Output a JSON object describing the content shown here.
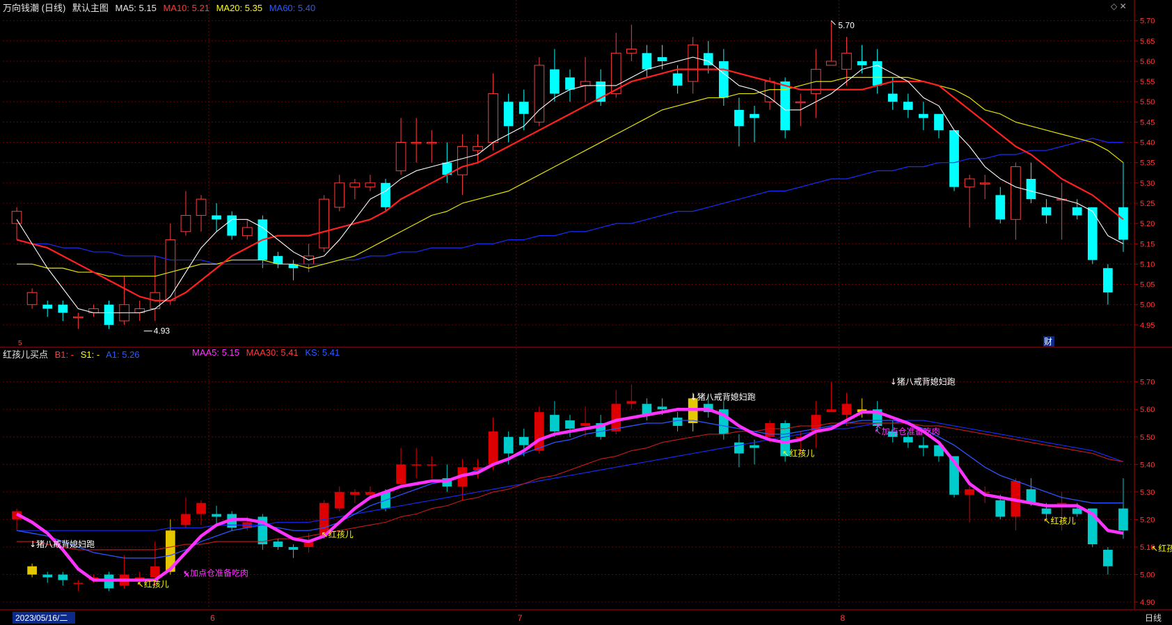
{
  "upper": {
    "title": "万向钱潮 (日线)",
    "indicator_name": "默认主图",
    "ma5": "MA5: 5.15",
    "ma10": "MA10: 5.21",
    "ma20": "MA20: 5.35",
    "ma60": "MA60: 5.40",
    "high_label": "5.70",
    "low_label": "4.93",
    "fin_marker": "财",
    "small_marker": "5"
  },
  "lower": {
    "indicator_name": "红孩儿买点",
    "b1": "B1: -",
    "s1": "S1: -",
    "a1": "A1: 5.26",
    "maa5": "MAA5: 5.15",
    "maa30": "MAA30: 5.41",
    "ks": "KS: 5.41",
    "annotations": [
      {
        "text": "↓猪八戒背媳妇跑",
        "color": "#ffffff",
        "bar": 1,
        "price": 5.1
      },
      {
        "text": "↖红孩儿",
        "color": "#ffff00",
        "bar": 8,
        "price": 4.955
      },
      {
        "text": "↖加点仓准备吃肉",
        "color": "#ff33ff",
        "bar": 11,
        "price": 4.995
      },
      {
        "text": "↖红孩儿",
        "color": "#ffff00",
        "bar": 20,
        "price": 5.135
      },
      {
        "text": "↓猪八戒背媳妇跑",
        "color": "#ffffff",
        "bar": 44,
        "price": 5.635
      },
      {
        "text": "↖红孩儿",
        "color": "#ffff00",
        "bar": 50,
        "price": 5.43
      },
      {
        "text": "↓猪八戒背媳妇跑",
        "color": "#ffffff",
        "bar": 57,
        "price": 5.69
      },
      {
        "text": "↖加点仓准备吃肉",
        "color": "#ff33ff",
        "bar": 56,
        "price": 5.51
      },
      {
        "text": "↖红孩儿",
        "color": "#ffff00",
        "bar": 67,
        "price": 5.185
      },
      {
        "text": "↖红孩儿",
        "color": "#ffff00",
        "bar": 74,
        "price": 5.085
      }
    ]
  },
  "bottom": {
    "date_label": "2023/05/16/二",
    "month_labels": [
      "6",
      "7",
      "8"
    ],
    "period": "日线"
  },
  "colors": {
    "up": "#ff3b3b",
    "down_upper": "#00ffff",
    "down_lower": "#00cccc",
    "up_lower": "#dd0000",
    "signal": "#e5c700",
    "ma5": "#ffffff",
    "ma10": "#ff2020",
    "ma20": "#e6e600",
    "ma60": "#1a2cff",
    "maa5": "#ff33ff",
    "grid": "#7a0000"
  },
  "chart_data": {
    "type": "candlestick",
    "ylim_upper": [
      4.9,
      5.72
    ],
    "ylim_lower": [
      4.88,
      5.78
    ],
    "yticks": [
      4.95,
      5.0,
      5.05,
      5.1,
      5.15,
      5.2,
      5.25,
      5.3,
      5.35,
      5.4,
      5.45,
      5.5,
      5.55,
      5.6,
      5.65,
      5.7
    ],
    "yticks_lower": [
      4.9,
      5.0,
      5.1,
      5.2,
      5.3,
      5.4,
      5.5,
      5.6,
      5.7
    ],
    "candles": [
      [
        5.2,
        5.23,
        5.24,
        5.16
      ],
      [
        5.0,
        5.03,
        5.04,
        4.99
      ],
      [
        5.0,
        4.99,
        5.01,
        4.97
      ],
      [
        5.0,
        4.98,
        5.01,
        4.96
      ],
      [
        4.97,
        4.97,
        4.98,
        4.94
      ],
      [
        4.98,
        4.99,
        5.0,
        4.97
      ],
      [
        5.0,
        4.95,
        5.01,
        4.94
      ],
      [
        4.96,
        5.0,
        5.07,
        4.95
      ],
      [
        4.98,
        4.99,
        5.01,
        4.96
      ],
      [
        4.99,
        5.03,
        5.12,
        4.96
      ],
      [
        5.01,
        5.16,
        5.2,
        5.0
      ],
      [
        5.18,
        5.22,
        5.28,
        5.17
      ],
      [
        5.22,
        5.26,
        5.27,
        5.18
      ],
      [
        5.22,
        5.21,
        5.25,
        5.18
      ],
      [
        5.22,
        5.17,
        5.23,
        5.16
      ],
      [
        5.17,
        5.19,
        5.21,
        5.16
      ],
      [
        5.21,
        5.11,
        5.22,
        5.09
      ],
      [
        5.12,
        5.1,
        5.13,
        5.09
      ],
      [
        5.1,
        5.09,
        5.11,
        5.06
      ],
      [
        5.1,
        5.12,
        5.15,
        5.08
      ],
      [
        5.14,
        5.26,
        5.27,
        5.13
      ],
      [
        5.24,
        5.3,
        5.32,
        5.23
      ],
      [
        5.29,
        5.3,
        5.31,
        5.26
      ],
      [
        5.29,
        5.3,
        5.32,
        5.28
      ],
      [
        5.3,
        5.24,
        5.31,
        5.23
      ],
      [
        5.33,
        5.4,
        5.46,
        5.32
      ],
      [
        5.4,
        5.4,
        5.46,
        5.35
      ],
      [
        5.4,
        5.4,
        5.43,
        5.35
      ],
      [
        5.35,
        5.32,
        5.4,
        5.3
      ],
      [
        5.32,
        5.39,
        5.42,
        5.27
      ],
      [
        5.38,
        5.39,
        5.42,
        5.35
      ],
      [
        5.4,
        5.52,
        5.57,
        5.38
      ],
      [
        5.5,
        5.44,
        5.52,
        5.4
      ],
      [
        5.5,
        5.47,
        5.53,
        5.43
      ],
      [
        5.45,
        5.59,
        5.61,
        5.44
      ],
      [
        5.58,
        5.52,
        5.63,
        5.5
      ],
      [
        5.56,
        5.53,
        5.58,
        5.5
      ],
      [
        5.54,
        5.55,
        5.61,
        5.5
      ],
      [
        5.55,
        5.5,
        5.58,
        5.49
      ],
      [
        5.52,
        5.62,
        5.67,
        5.51
      ],
      [
        5.62,
        5.63,
        5.69,
        5.6
      ],
      [
        5.62,
        5.58,
        5.64,
        5.56
      ],
      [
        5.61,
        5.6,
        5.64,
        5.58
      ],
      [
        5.57,
        5.54,
        5.59,
        5.52
      ],
      [
        5.55,
        5.64,
        5.66,
        5.52
      ],
      [
        5.62,
        5.59,
        5.65,
        5.57
      ],
      [
        5.6,
        5.51,
        5.63,
        5.49
      ],
      [
        5.48,
        5.44,
        5.51,
        5.39
      ],
      [
        5.47,
        5.46,
        5.49,
        5.4
      ],
      [
        5.5,
        5.55,
        5.56,
        5.48
      ],
      [
        5.55,
        5.43,
        5.56,
        5.41
      ],
      [
        5.5,
        5.5,
        5.52,
        5.44
      ],
      [
        5.52,
        5.58,
        5.63,
        5.46
      ],
      [
        5.59,
        5.6,
        5.7,
        5.59
      ],
      [
        5.58,
        5.62,
        5.66,
        5.54
      ],
      [
        5.6,
        5.59,
        5.64,
        5.57
      ],
      [
        5.6,
        5.54,
        5.63,
        5.52
      ],
      [
        5.52,
        5.5,
        5.56,
        5.48
      ],
      [
        5.5,
        5.48,
        5.52,
        5.46
      ],
      [
        5.47,
        5.46,
        5.5,
        5.43
      ],
      [
        5.47,
        5.43,
        5.47,
        5.41
      ],
      [
        5.43,
        5.29,
        5.43,
        5.28
      ],
      [
        5.29,
        5.31,
        5.32,
        5.19
      ],
      [
        5.3,
        5.3,
        5.32,
        5.26
      ],
      [
        5.27,
        5.21,
        5.29,
        5.2
      ],
      [
        5.21,
        5.34,
        5.35,
        5.16
      ],
      [
        5.31,
        5.26,
        5.35,
        5.25
      ],
      [
        5.24,
        5.22,
        5.26,
        5.2
      ],
      [
        5.26,
        5.26,
        5.3,
        5.16
      ],
      [
        5.24,
        5.22,
        5.26,
        5.21
      ],
      [
        5.24,
        5.11,
        5.24,
        5.1
      ],
      [
        5.09,
        5.03,
        5.1,
        5.0
      ],
      [
        5.24,
        5.16,
        5.35,
        5.13
      ]
    ],
    "ma5": [
      5.21,
      5.15,
      5.09,
      5.04,
      4.99,
      4.98,
      4.98,
      4.98,
      4.98,
      4.99,
      5.02,
      5.08,
      5.14,
      5.18,
      5.21,
      5.21,
      5.19,
      5.16,
      5.13,
      5.11,
      5.12,
      5.16,
      5.21,
      5.26,
      5.28,
      5.31,
      5.33,
      5.34,
      5.35,
      5.36,
      5.37,
      5.4,
      5.42,
      5.44,
      5.48,
      5.51,
      5.53,
      5.54,
      5.54,
      5.54,
      5.56,
      5.58,
      5.59,
      5.6,
      5.61,
      5.6,
      5.57,
      5.54,
      5.53,
      5.51,
      5.48,
      5.48,
      5.5,
      5.52,
      5.55,
      5.58,
      5.59,
      5.57,
      5.55,
      5.51,
      5.49,
      5.43,
      5.39,
      5.34,
      5.31,
      5.29,
      5.28,
      5.27,
      5.26,
      5.25,
      5.23,
      5.17,
      5.15
    ],
    "ma10": [
      5.16,
      5.15,
      5.14,
      5.12,
      5.1,
      5.08,
      5.06,
      5.04,
      5.02,
      5.01,
      5.01,
      5.03,
      5.06,
      5.09,
      5.12,
      5.14,
      5.16,
      5.17,
      5.17,
      5.17,
      5.18,
      5.19,
      5.2,
      5.21,
      5.23,
      5.26,
      5.28,
      5.3,
      5.32,
      5.34,
      5.35,
      5.37,
      5.39,
      5.41,
      5.43,
      5.45,
      5.47,
      5.49,
      5.51,
      5.53,
      5.55,
      5.56,
      5.57,
      5.58,
      5.58,
      5.58,
      5.58,
      5.57,
      5.56,
      5.55,
      5.54,
      5.53,
      5.53,
      5.53,
      5.53,
      5.53,
      5.54,
      5.55,
      5.55,
      5.55,
      5.54,
      5.51,
      5.48,
      5.45,
      5.42,
      5.39,
      5.37,
      5.34,
      5.31,
      5.29,
      5.27,
      5.24,
      5.21
    ],
    "ma20": [
      5.1,
      5.1,
      5.09,
      5.09,
      5.08,
      5.08,
      5.07,
      5.07,
      5.07,
      5.07,
      5.08,
      5.09,
      5.1,
      5.1,
      5.11,
      5.11,
      5.11,
      5.1,
      5.1,
      5.09,
      5.1,
      5.11,
      5.12,
      5.14,
      5.16,
      5.18,
      5.2,
      5.22,
      5.23,
      5.25,
      5.26,
      5.27,
      5.28,
      5.3,
      5.32,
      5.34,
      5.36,
      5.38,
      5.4,
      5.42,
      5.44,
      5.46,
      5.48,
      5.49,
      5.5,
      5.51,
      5.51,
      5.52,
      5.52,
      5.53,
      5.53,
      5.54,
      5.55,
      5.55,
      5.56,
      5.56,
      5.56,
      5.56,
      5.56,
      5.55,
      5.54,
      5.53,
      5.51,
      5.48,
      5.47,
      5.45,
      5.44,
      5.43,
      5.42,
      5.41,
      5.4,
      5.38,
      5.35
    ],
    "ma60": [
      5.16,
      5.15,
      5.15,
      5.14,
      5.14,
      5.13,
      5.13,
      5.12,
      5.12,
      5.12,
      5.11,
      5.11,
      5.11,
      5.1,
      5.1,
      5.1,
      5.1,
      5.1,
      5.1,
      5.1,
      5.1,
      5.11,
      5.11,
      5.12,
      5.12,
      5.13,
      5.13,
      5.14,
      5.14,
      5.14,
      5.15,
      5.15,
      5.16,
      5.16,
      5.17,
      5.17,
      5.18,
      5.18,
      5.19,
      5.2,
      5.2,
      5.21,
      5.22,
      5.23,
      5.23,
      5.24,
      5.25,
      5.26,
      5.27,
      5.28,
      5.28,
      5.29,
      5.3,
      5.31,
      5.31,
      5.32,
      5.33,
      5.33,
      5.34,
      5.34,
      5.35,
      5.35,
      5.36,
      5.36,
      5.37,
      5.37,
      5.38,
      5.38,
      5.39,
      5.4,
      5.41,
      5.4,
      5.4
    ],
    "maa5": [
      5.22,
      5.19,
      5.15,
      5.09,
      5.02,
      4.98,
      4.98,
      4.98,
      4.98,
      4.98,
      5.02,
      5.08,
      5.14,
      5.18,
      5.2,
      5.2,
      5.19,
      5.16,
      5.13,
      5.12,
      5.14,
      5.19,
      5.24,
      5.28,
      5.3,
      5.32,
      5.33,
      5.34,
      5.34,
      5.36,
      5.37,
      5.4,
      5.42,
      5.45,
      5.49,
      5.51,
      5.52,
      5.53,
      5.54,
      5.56,
      5.57,
      5.58,
      5.59,
      5.6,
      5.6,
      5.6,
      5.58,
      5.54,
      5.51,
      5.49,
      5.48,
      5.49,
      5.52,
      5.53,
      5.56,
      5.59,
      5.59,
      5.57,
      5.55,
      5.52,
      5.48,
      5.41,
      5.33,
      5.29,
      5.28,
      5.27,
      5.26,
      5.25,
      5.25,
      5.25,
      5.22,
      5.16,
      5.15
    ],
    "blue_lower": [
      5.16,
      5.15,
      5.14,
      5.12,
      5.1,
      5.08,
      5.07,
      5.06,
      5.06,
      5.06,
      5.07,
      5.09,
      5.12,
      5.14,
      5.16,
      5.17,
      5.18,
      5.17,
      5.16,
      5.16,
      5.17,
      5.19,
      5.22,
      5.25,
      5.27,
      5.29,
      5.31,
      5.33,
      5.34,
      5.36,
      5.38,
      5.4,
      5.42,
      5.44,
      5.46,
      5.48,
      5.49,
      5.51,
      5.52,
      5.53,
      5.54,
      5.55,
      5.55,
      5.56,
      5.56,
      5.55,
      5.54,
      5.53,
      5.52,
      5.51,
      5.51,
      5.52,
      5.53,
      5.54,
      5.55,
      5.56,
      5.56,
      5.56,
      5.55,
      5.53,
      5.5,
      5.47,
      5.43,
      5.39,
      5.36,
      5.34,
      5.32,
      5.3,
      5.28,
      5.27,
      5.26,
      5.26,
      5.26
    ],
    "red_lower": [
      5.12,
      5.12,
      5.11,
      5.1,
      5.09,
      5.09,
      5.09,
      5.09,
      5.09,
      5.09,
      5.1,
      5.11,
      5.11,
      5.12,
      5.12,
      5.12,
      5.12,
      5.13,
      5.13,
      5.14,
      5.15,
      5.16,
      5.17,
      5.18,
      5.19,
      5.21,
      5.22,
      5.24,
      5.25,
      5.27,
      5.28,
      5.3,
      5.31,
      5.33,
      5.35,
      5.36,
      5.38,
      5.4,
      5.42,
      5.43,
      5.45,
      5.46,
      5.48,
      5.49,
      5.5,
      5.51,
      5.51,
      5.52,
      5.52,
      5.53,
      5.53,
      5.54,
      5.54,
      5.55,
      5.55,
      5.55,
      5.55,
      5.55,
      5.55,
      5.54,
      5.54,
      5.53,
      5.52,
      5.51,
      5.5,
      5.49,
      5.48,
      5.47,
      5.46,
      5.45,
      5.44,
      5.42,
      5.41
    ],
    "navy_lower": [
      5.16,
      5.16,
      5.16,
      5.16,
      5.16,
      5.16,
      5.16,
      5.16,
      5.16,
      5.16,
      5.17,
      5.17,
      5.17,
      5.18,
      5.18,
      5.18,
      5.18,
      5.19,
      5.19,
      5.19,
      5.2,
      5.21,
      5.22,
      5.23,
      5.24,
      5.25,
      5.26,
      5.27,
      5.28,
      5.29,
      5.3,
      5.31,
      5.32,
      5.33,
      5.34,
      5.35,
      5.36,
      5.37,
      5.38,
      5.39,
      5.4,
      5.41,
      5.42,
      5.43,
      5.44,
      5.45,
      5.46,
      5.47,
      5.48,
      5.49,
      5.5,
      5.51,
      5.52,
      5.53,
      5.53,
      5.54,
      5.55,
      5.55,
      5.56,
      5.56,
      5.55,
      5.54,
      5.53,
      5.52,
      5.51,
      5.5,
      5.49,
      5.48,
      5.47,
      5.46,
      5.45,
      5.43,
      5.41
    ],
    "signal_bars": [
      1,
      10,
      44,
      55
    ],
    "x_month_starts": [
      13,
      33,
      54
    ]
  }
}
